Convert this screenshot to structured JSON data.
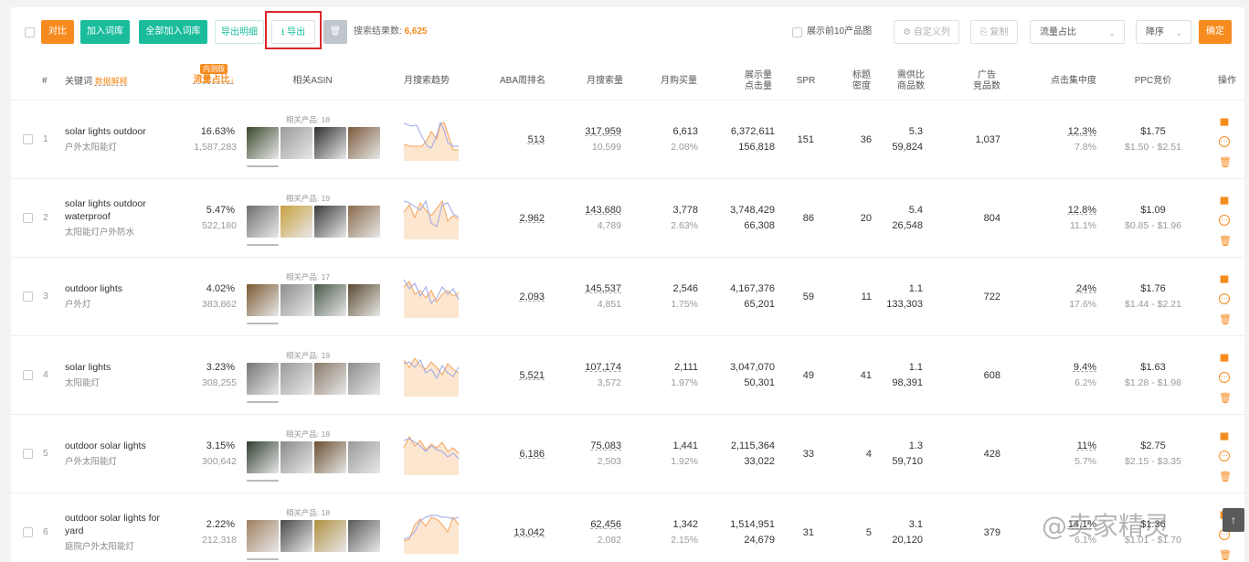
{
  "toolbar": {
    "compare": "对比",
    "add_lexicon": "加入词库",
    "add_all_lexicon": "全部加入词库",
    "export_detail": "导出明细",
    "export": "导出",
    "result_label": "搜索结果数:",
    "result_count": "6,625",
    "show_top10": "展示前10产品图",
    "custom_cols": "自定义列",
    "copy": "复制",
    "sort_field": "流量占比",
    "sort_order": "降序",
    "confirm": "确定"
  },
  "columns": {
    "index": "#",
    "keyword": "关键词",
    "data_explain": "数据解释",
    "badge": "内测版",
    "traffic_share": "流量占比",
    "related_asin": "相关ASIN",
    "trend": "月搜索趋势",
    "aba_rank": "ABA周排名",
    "monthly_search": "月搜索量",
    "monthly_purchase": "月购买量",
    "impressions_l1": "展示量",
    "impressions_l2": "点击量",
    "spr": "SPR",
    "title_l1": "标题",
    "title_l2": "密度",
    "supply_l1": "需供比",
    "supply_l2": "商品数",
    "ads_l1": "广告",
    "ads_l2": "竞品数",
    "click_conc": "点击集中度",
    "ppc": "PPC竞价",
    "ops": "操作"
  },
  "rows": [
    {
      "idx": "1",
      "kw": "solar lights outdoor",
      "kw2": "",
      "cn": "户外太阳能灯",
      "share": "16.63%",
      "share_sub": "1,587,283",
      "related": "相关产品: 18",
      "aba": "513",
      "search": "317,959",
      "search_sub": "10,599",
      "purchase": "6,613",
      "purchase_sub": "2.08%",
      "impr": "6,372,611",
      "clicks": "156,818",
      "spr": "151",
      "title": "36",
      "supply": "5.3",
      "supply_sub": "59,824",
      "ads": "1,037",
      "conc": "12.3%",
      "conc_sub": "7.8%",
      "ppc": "$1.75",
      "ppc_range": "$1.50 - $2.51"
    },
    {
      "idx": "2",
      "kw": "solar lights outdoor",
      "kw2": "waterproof",
      "cn": "太阳能灯户外防水",
      "share": "5.47%",
      "share_sub": "522,180",
      "related": "相关产品: 19",
      "aba": "2,962",
      "search": "143,680",
      "search_sub": "4,789",
      "purchase": "3,778",
      "purchase_sub": "2.63%",
      "impr": "3,748,429",
      "clicks": "66,308",
      "spr": "86",
      "title": "20",
      "supply": "5.4",
      "supply_sub": "26,548",
      "ads": "804",
      "conc": "12.8%",
      "conc_sub": "11.1%",
      "ppc": "$1.09",
      "ppc_range": "$0.85 - $1.96"
    },
    {
      "idx": "3",
      "kw": "outdoor lights",
      "kw2": "",
      "cn": "户外灯",
      "share": "4.02%",
      "share_sub": "383,862",
      "related": "相关产品: 17",
      "aba": "2,093",
      "search": "145,537",
      "search_sub": "4,851",
      "purchase": "2,546",
      "purchase_sub": "1.75%",
      "impr": "4,167,376",
      "clicks": "65,201",
      "spr": "59",
      "title": "11",
      "supply": "1.1",
      "supply_sub": "133,303",
      "ads": "722",
      "conc": "24%",
      "conc_sub": "17.6%",
      "ppc": "$1.76",
      "ppc_range": "$1.44 - $2.21"
    },
    {
      "idx": "4",
      "kw": "solar lights",
      "kw2": "",
      "cn": "太阳能灯",
      "share": "3.23%",
      "share_sub": "308,255",
      "related": "相关产品: 19",
      "aba": "5,521",
      "search": "107,174",
      "search_sub": "3,572",
      "purchase": "2,111",
      "purchase_sub": "1.97%",
      "impr": "3,047,070",
      "clicks": "50,301",
      "spr": "49",
      "title": "41",
      "supply": "1.1",
      "supply_sub": "98,391",
      "ads": "608",
      "conc": "9.4%",
      "conc_sub": "6.2%",
      "ppc": "$1.63",
      "ppc_range": "$1.28 - $1.98"
    },
    {
      "idx": "5",
      "kw": "outdoor solar lights",
      "kw2": "",
      "cn": "户外太阳能灯",
      "share": "3.15%",
      "share_sub": "300,642",
      "related": "相关产品: 18",
      "aba": "6,186",
      "search": "75,083",
      "search_sub": "2,503",
      "purchase": "1,441",
      "purchase_sub": "1.92%",
      "impr": "2,115,364",
      "clicks": "33,022",
      "spr": "33",
      "title": "4",
      "supply": "1.3",
      "supply_sub": "59,710",
      "ads": "428",
      "conc": "11%",
      "conc_sub": "5.7%",
      "ppc": "$2.75",
      "ppc_range": "$2.15 - $3.35"
    },
    {
      "idx": "6",
      "kw": "outdoor solar lights for",
      "kw2": "yard",
      "cn": "庭院户外太阳能灯",
      "share": "2.22%",
      "share_sub": "212,318",
      "related": "相关产品: 18",
      "aba": "13,042",
      "search": "62,456",
      "search_sub": "2,082",
      "purchase": "1,342",
      "purchase_sub": "2.15%",
      "impr": "1,514,951",
      "clicks": "24,679",
      "spr": "31",
      "title": "5",
      "supply": "3.1",
      "supply_sub": "20,120",
      "ads": "379",
      "conc": "14.1%",
      "conc_sub": "6.1%",
      "ppc": "$1.36",
      "ppc_range": "$1.01 - $1.70"
    }
  ],
  "watermark": "@卖家精灵",
  "colors": {
    "accent": "#f68b1f",
    "teal": "#1abc9c",
    "trend_search": "#9aa8e6",
    "trend_purchase": "#f5a25a",
    "red_highlight": "#d9282b"
  },
  "icons": {
    "export": "download-icon",
    "delete": "trash-icon",
    "custom": "gear-icon",
    "copy": "copy-icon",
    "chart": "bar-chart-icon",
    "more": "more-icon",
    "remove": "trash-icon",
    "scroll": "arrow-up-icon"
  }
}
